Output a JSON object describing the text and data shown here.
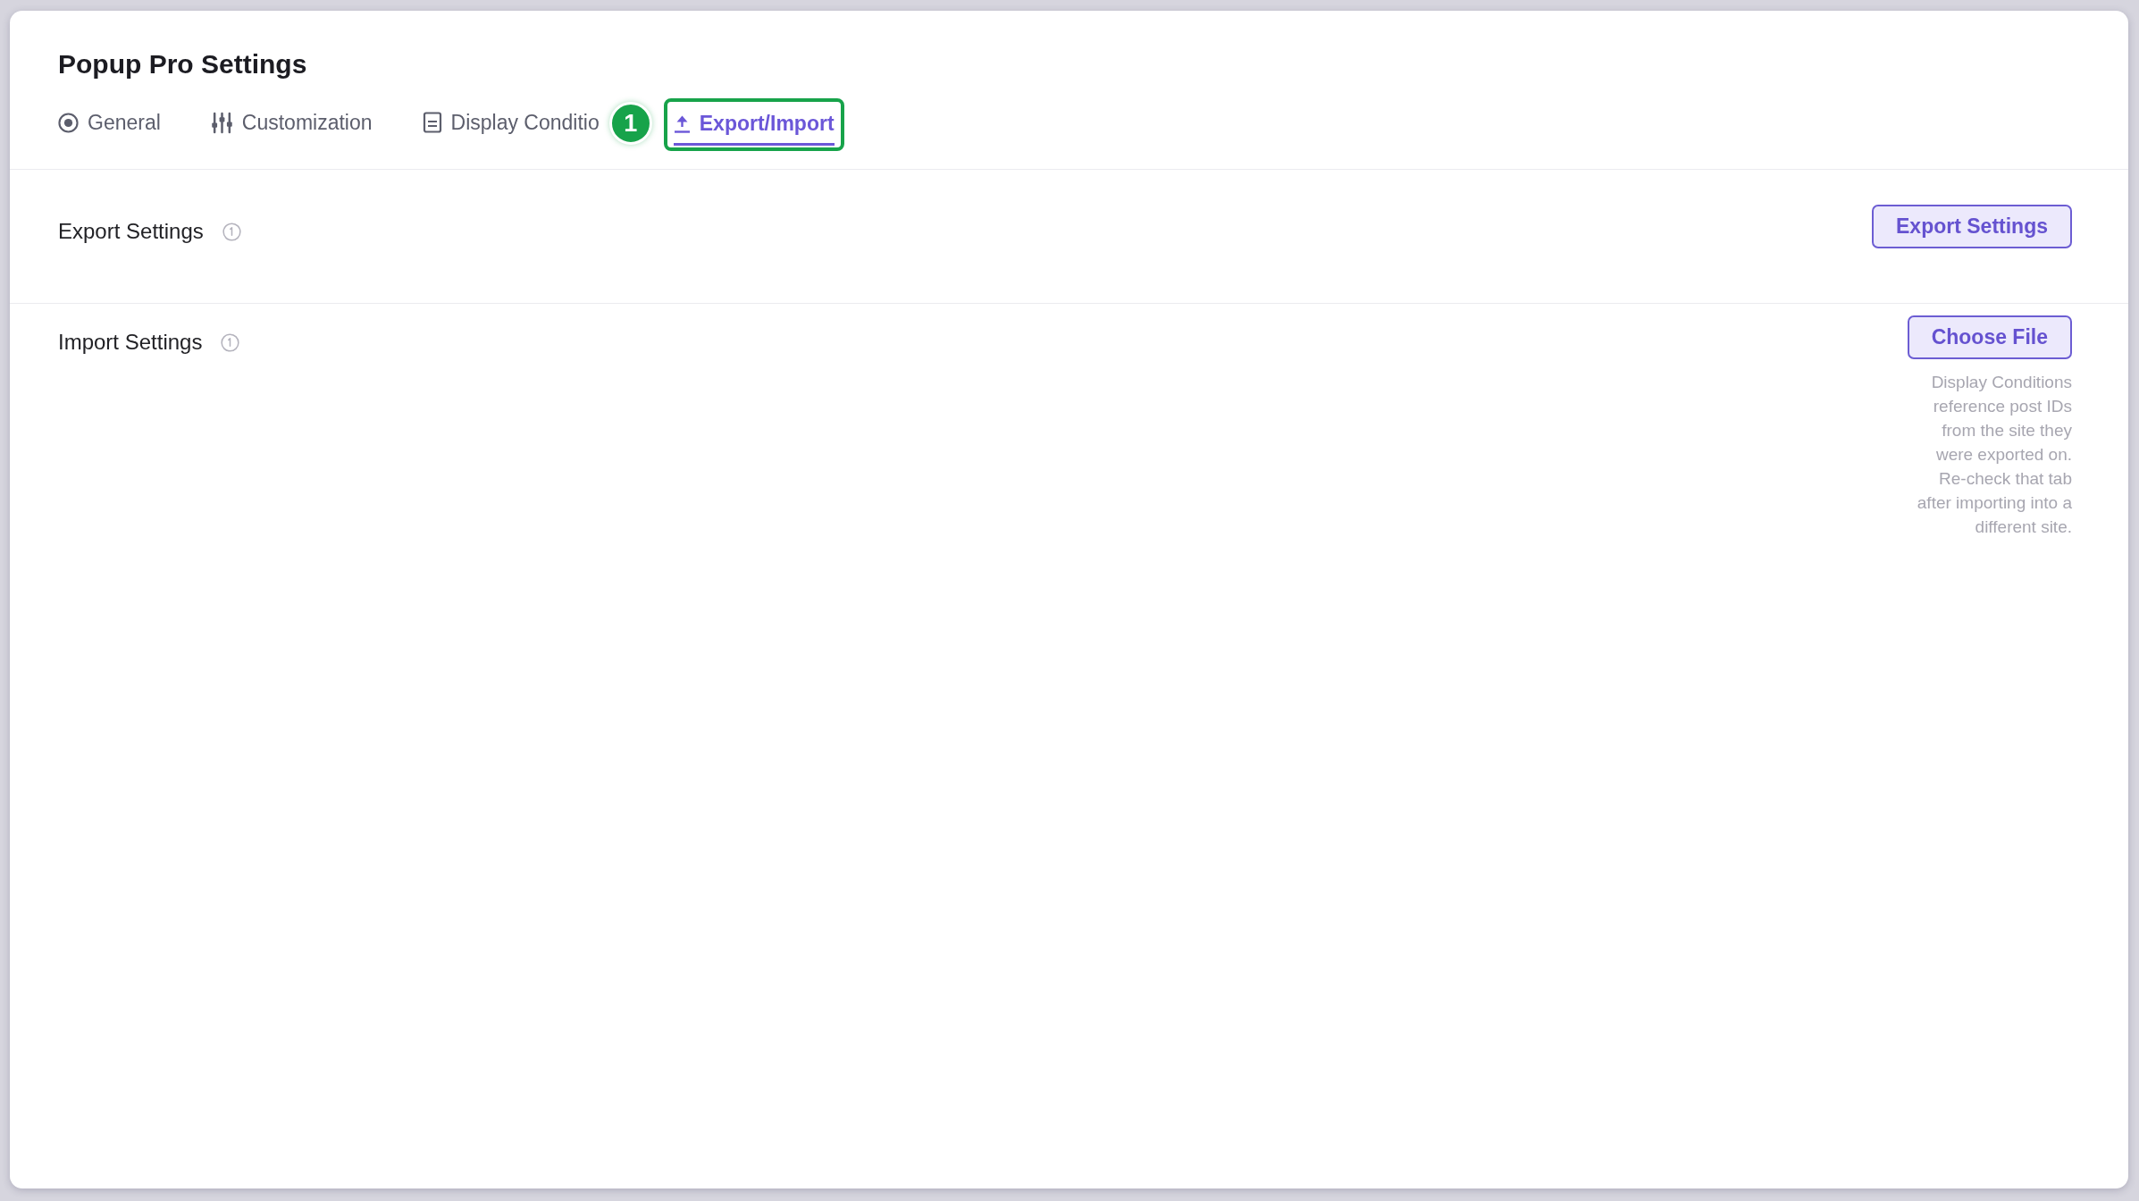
{
  "page": {
    "title": "Popup Pro Settings"
  },
  "tabs": [
    {
      "label": "General",
      "selected": false
    },
    {
      "label": "Customization",
      "selected": false
    },
    {
      "label": "Display Conditio",
      "selected": false
    },
    {
      "label": "Export/Import",
      "selected": true,
      "annotation": {
        "number": "1"
      }
    }
  ],
  "sections": [
    {
      "label": "Export Settings",
      "button": "Export Settings"
    },
    {
      "label": "Import Settings",
      "button": "Choose File",
      "help": "Display Conditions reference post IDs from the site they were exported on. Re-check that tab after importing into a different site."
    }
  ]
}
